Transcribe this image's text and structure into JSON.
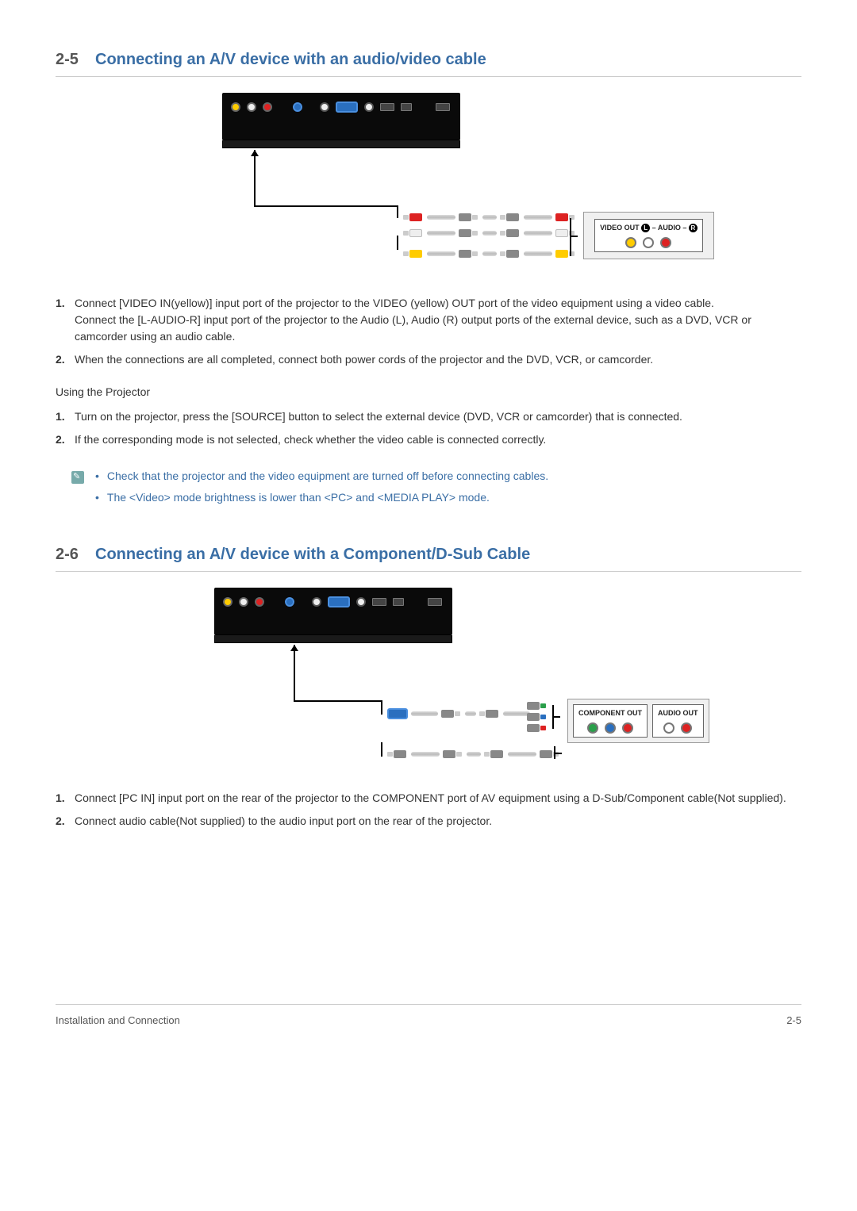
{
  "section1": {
    "number": "2-5",
    "title": "Connecting an A/V device with an audio/video cable",
    "ext_box_label_pre": "VIDEO OUT ",
    "ext_box_l": "L",
    "ext_box_mid": "– AUDIO –",
    "ext_box_r": "R",
    "steps": [
      {
        "num": "1.",
        "text": "Connect [VIDEO IN(yellow)] input port of the projector to the VIDEO (yellow) OUT port of the video equipment using a video cable.\nConnect the [L-AUDIO-R] input port of the projector to the Audio (L), Audio (R) output ports of the external device, such as a DVD, VCR or camcorder using an audio cable."
      },
      {
        "num": "2.",
        "text": "When the connections are all completed, connect both power cords of the projector and the DVD, VCR, or camcorder."
      }
    ],
    "subhead": "Using the Projector",
    "steps2": [
      {
        "num": "1.",
        "text": "Turn on the projector, press the [SOURCE] button to select the external device (DVD, VCR or camcorder) that is connected."
      },
      {
        "num": "2.",
        "text": "If the corresponding mode is not selected, check whether the video cable is connected correctly."
      }
    ],
    "notes": [
      "Check that the projector and the video equipment are turned off before connecting cables.",
      "The <Video> mode brightness is lower than <PC> and <MEDIA PLAY> mode."
    ]
  },
  "section2": {
    "number": "2-6",
    "title": "Connecting an A/V device with a Component/D-Sub Cable",
    "ext_box1_label": "COMPONENT OUT",
    "ext_box2_label": "AUDIO OUT",
    "steps": [
      {
        "num": "1.",
        "text": "Connect [PC IN] input port on the rear of the projector to the COMPONENT port of AV equipment using a D-Sub/Component cable(Not supplied)."
      },
      {
        "num": "2.",
        "text": "Connect audio cable(Not supplied) to the audio input port on the rear of the projector."
      }
    ]
  },
  "footer": {
    "left": "Installation and Connection",
    "right": "2-5"
  }
}
